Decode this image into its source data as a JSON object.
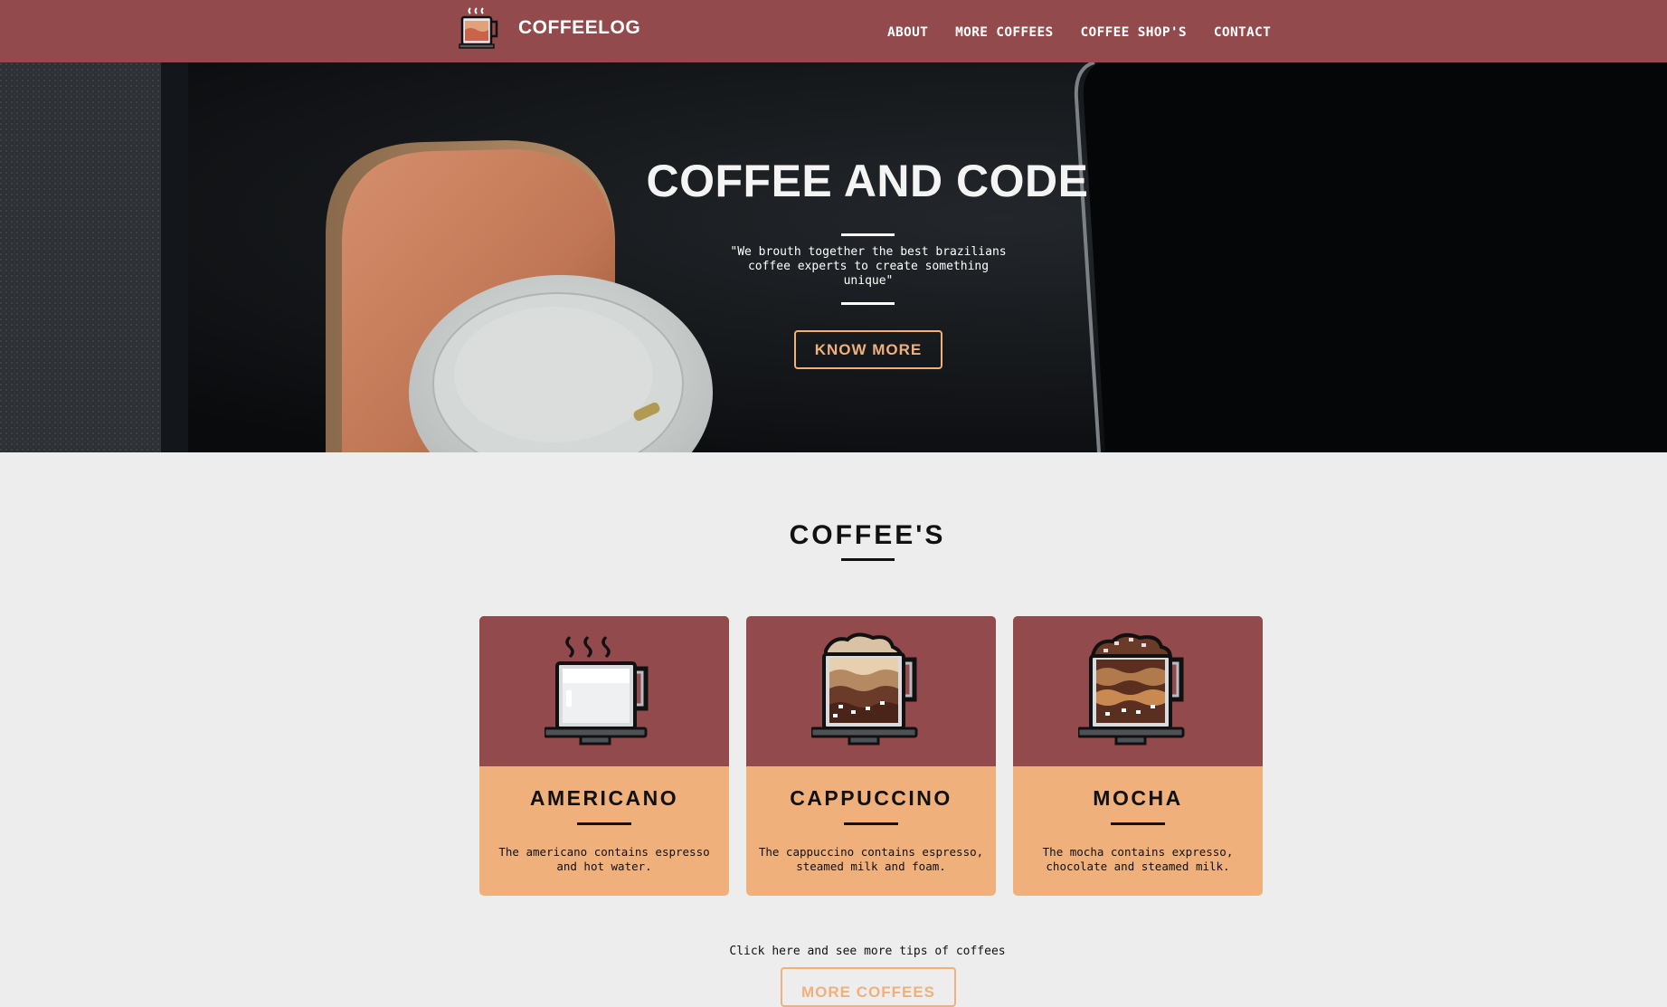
{
  "header": {
    "brand": "COFFEELOG",
    "nav": [
      {
        "label": "ABOUT"
      },
      {
        "label": "MORE COFFEES"
      },
      {
        "label": "COFFEE SHOP'S"
      },
      {
        "label": "CONTACT"
      }
    ]
  },
  "hero": {
    "title": "COFFEE AND CODE",
    "quote": "\"We brouth together the best brazilians coffee experts to create something unique\"",
    "button_label": "KNOW MORE"
  },
  "coffees": {
    "title": "COFFEE'S",
    "cards": [
      {
        "name": "AMERICANO",
        "description": "The americano contains espresso and hot water."
      },
      {
        "name": "CAPPUCCINO",
        "description": "The cappuccino contains espresso, steamed milk and foam."
      },
      {
        "name": "MOCHA",
        "description": "The mocha contains expresso, chocolate and steamed milk."
      }
    ],
    "tips_text": "Click here and see more tips of coffees",
    "more_button_label": "MORE COFFEES"
  },
  "colors": {
    "brand": "#924a4c",
    "accent": "#f0b07c",
    "background": "#ededed"
  },
  "icons": {
    "logo": "coffee-cup-icon",
    "americano": "americano-cup-icon",
    "cappuccino": "cappuccino-cup-icon",
    "mocha": "mocha-cup-icon"
  }
}
